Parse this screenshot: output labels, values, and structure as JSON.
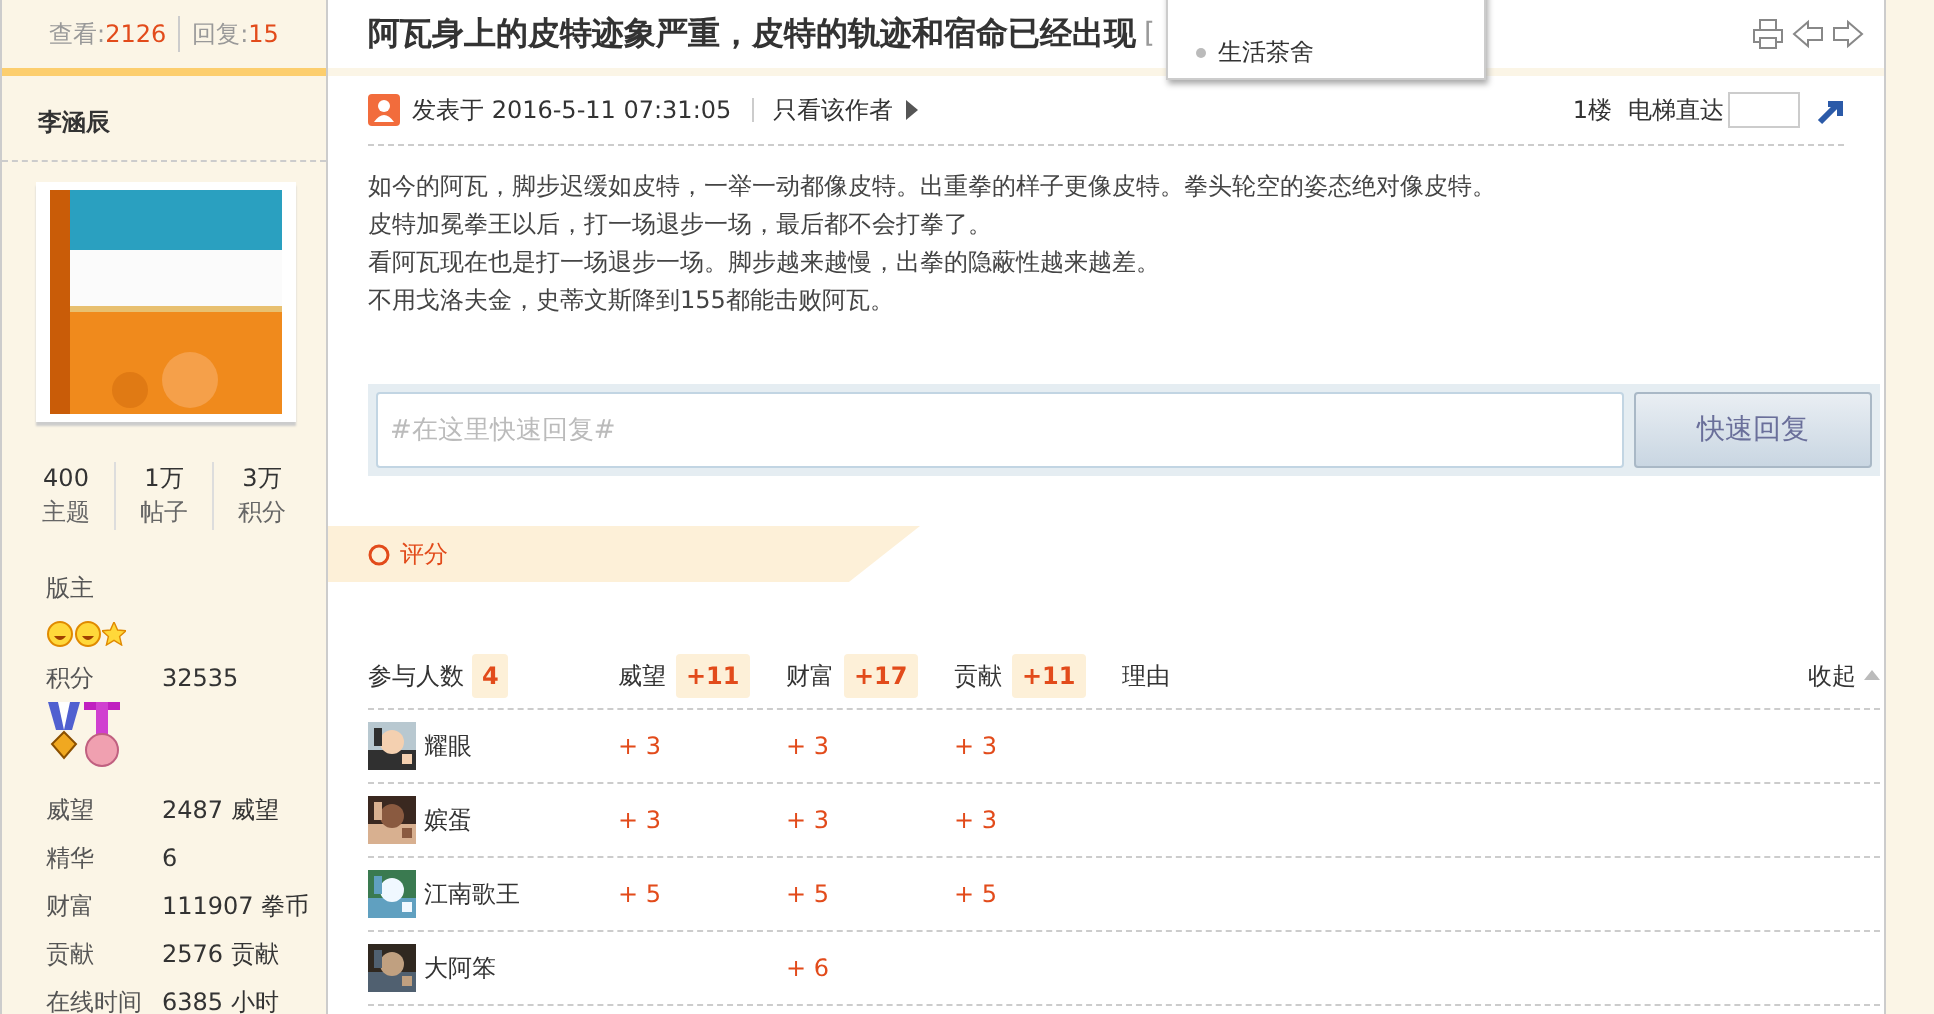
{
  "sidebar": {
    "views": {
      "label": "查看:",
      "value": "2126"
    },
    "replies": {
      "label": "回复:",
      "value": "15"
    },
    "username": "李涵辰",
    "stats": [
      {
        "value": "400",
        "label": "主题"
      },
      {
        "value": "1万",
        "label": "帖子"
      },
      {
        "value": "3万",
        "label": "积分"
      }
    ],
    "group": "版主",
    "points": {
      "label": "积分",
      "value": "32535"
    },
    "profile": [
      {
        "label": "威望",
        "value": "2487 威望"
      },
      {
        "label": "精华",
        "value": "6"
      },
      {
        "label": "财富",
        "value": "111907 拳币"
      },
      {
        "label": "贡献",
        "value": "2576 贡献"
      },
      {
        "label": "在线时间",
        "value": "6385 小时"
      }
    ]
  },
  "thread": {
    "title": "阿瓦身上的皮特迹象严重，皮特的轨迹和宿命已经出现",
    "title_suffix": "["
  },
  "dropdown": {
    "items": [
      {
        "label": "生活茶舍"
      }
    ]
  },
  "post": {
    "posted": "发表于 2016-5-11 07:31:05",
    "author_only": "只看该作者",
    "floor": "1楼",
    "jump_label": "电梯直达",
    "body": [
      "如今的阿瓦，脚步迟缓如皮特，一举一动都像皮特。出重拳的样子更像皮特。拳头轮空的姿态绝对像皮特。",
      "皮特加冕拳王以后，打一场退步一场，最后都不会打拳了。",
      "看阿瓦现在也是打一场退步一场。脚步越来越慢，出拳的隐蔽性越来越差。",
      "不用戈洛夫金，史蒂文斯降到155都能击败阿瓦。"
    ]
  },
  "quick_reply": {
    "placeholder": "#在这里快速回复#",
    "button": "快速回复"
  },
  "rating": {
    "title": "评分",
    "columns": [
      {
        "label": "参与人数",
        "total": "4"
      },
      {
        "label": "威望",
        "total": "+11"
      },
      {
        "label": "财富",
        "total": "+17"
      },
      {
        "label": "贡献",
        "total": "+11"
      },
      {
        "label": "理由"
      }
    ],
    "collapse": "收起",
    "rows": [
      {
        "cells": [
          "耀眼",
          "+ 3",
          "+ 3",
          "+ 3"
        ]
      },
      {
        "cells": [
          "嫔蛋",
          "+ 3",
          "+ 3",
          "+ 3"
        ]
      },
      {
        "cells": [
          "江南歌王",
          "+ 5",
          "+ 5",
          "+ 5"
        ]
      },
      {
        "cells": [
          "大阿笨",
          "",
          "+ 6"
        ]
      }
    ]
  }
}
